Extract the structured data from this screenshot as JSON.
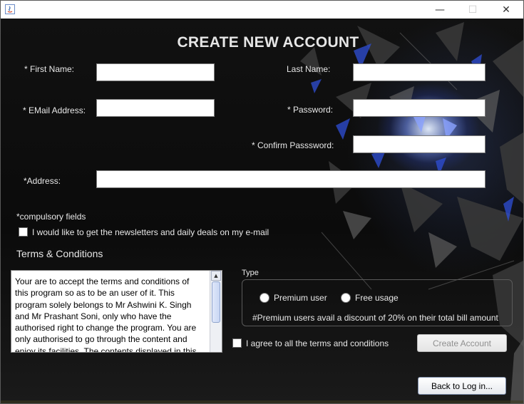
{
  "window": {
    "minimize_glyph": "—",
    "maximize_glyph": "☐",
    "close_glyph": "✕",
    "app_icon": "java-icon"
  },
  "form": {
    "title": "CREATE NEW ACCOUNT",
    "first_name_label": "* First Name:",
    "last_name_label": "Last Name:",
    "email_label": "* EMail Address:",
    "password_label": "* Password:",
    "confirm_password_label": "* Confirm Passsword:",
    "address_label": "*Address:",
    "first_name_value": "",
    "last_name_value": "",
    "email_value": "",
    "password_value": "",
    "confirm_password_value": "",
    "address_value": "",
    "compulsory_note": "*compulsory fields",
    "newsletter_label": "I would like to get the newsletters and daily deals on my e-mail"
  },
  "terms": {
    "heading": "Terms & Conditions",
    "text": "Your are to accept the terms and conditions of this program so as to be an user of it. This program solely belongs to Mr Ashwini K. Singh and Mr Prashant Soni, only who have the authorised right to change the program. You are only authorised to go through the content and enjoy its facilities. The contents displayed in this",
    "agree_label": "I agree to all the terms and conditions"
  },
  "type": {
    "legend": "Type",
    "premium_label": "Premium user",
    "free_label": "Free usage",
    "premium_note": "#Premium users avail a discount of 20% on their total bill amount"
  },
  "buttons": {
    "create_account": "Create Account",
    "back_to_login": "Back to Log in..."
  },
  "colors": {
    "label_text": "#e8e8e8",
    "highlight_blue": "#4a6cff"
  }
}
